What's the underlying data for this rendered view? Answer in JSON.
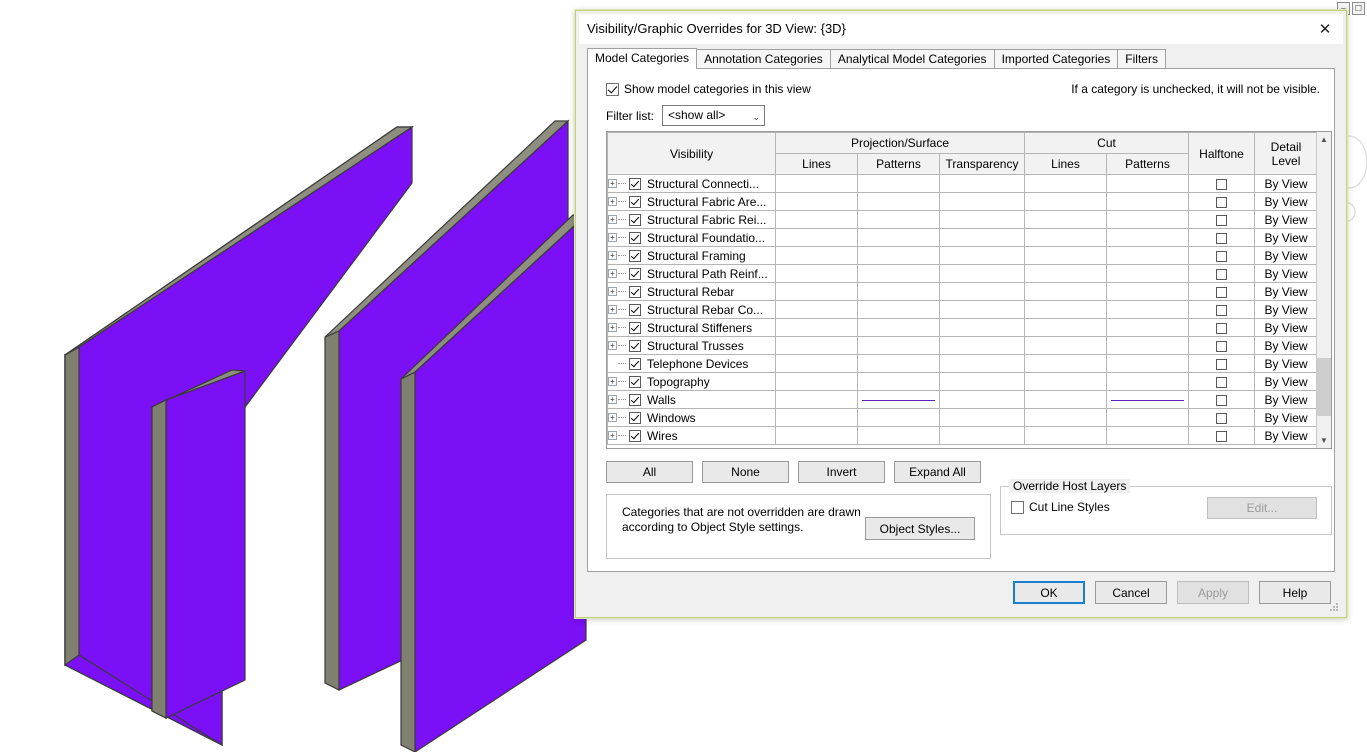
{
  "window": {
    "controls": [
      "minimize-icon",
      "restore-icon"
    ]
  },
  "view3d": {
    "name": "3D View {3D}",
    "wall_face_color": "#7B0FF5",
    "wall_edge_color": "#808070",
    "wall_outline_color": "#3a3a3a",
    "background": "#FFFFFF",
    "wall_count": 4
  },
  "dialog": {
    "title": "Visibility/Graphic Overrides for 3D View: {3D}",
    "close_label": "✕",
    "border_color": "#C0D17A",
    "tabs": [
      {
        "label": "Model Categories",
        "active": true
      },
      {
        "label": "Annotation Categories",
        "active": false
      },
      {
        "label": "Analytical Model Categories",
        "active": false
      },
      {
        "label": "Imported Categories",
        "active": false
      },
      {
        "label": "Filters",
        "active": false
      }
    ],
    "show_categories": {
      "label": "Show model categories in this view",
      "checked": true
    },
    "hint": "If a category is unchecked, it will not be visible.",
    "filter": {
      "label": "Filter list:",
      "value": "<show all>",
      "arrow": "⌄"
    },
    "grid": {
      "headers": {
        "visibility": "Visibility",
        "projection_surface": "Projection/Surface",
        "cut": "Cut",
        "lines": "Lines",
        "patterns": "Patterns",
        "transparency": "Transparency",
        "cut_lines": "Lines",
        "cut_patterns": "Patterns",
        "halftone": "Halftone",
        "detail_level": "Detail\nLevel",
        "detail_level_l1": "Detail",
        "detail_level_l2": "Level"
      },
      "rows": [
        {
          "name": "Structural Connecti...",
          "expandable": true,
          "checked": true,
          "detail": "By View",
          "halftone": false,
          "hatch": [],
          "purple": []
        },
        {
          "name": "Structural Fabric Are...",
          "expandable": true,
          "checked": true,
          "detail": "By View",
          "halftone": false,
          "hatch": [
            "pat",
            "trans",
            "cutpat"
          ],
          "purple": []
        },
        {
          "name": "Structural Fabric Rei...",
          "expandable": true,
          "checked": true,
          "detail": "By View",
          "halftone": false,
          "hatch": [
            "pat",
            "trans",
            "cutpat"
          ],
          "purple": []
        },
        {
          "name": "Structural Foundatio...",
          "expandable": true,
          "checked": true,
          "detail": "By View",
          "halftone": false,
          "hatch": [],
          "purple": []
        },
        {
          "name": "Structural Framing",
          "expandable": true,
          "checked": true,
          "detail": "By View",
          "halftone": false,
          "hatch": [],
          "purple": []
        },
        {
          "name": "Structural Path Reinf...",
          "expandable": true,
          "checked": true,
          "detail": "By View",
          "halftone": false,
          "hatch": [
            "pat",
            "cutpat"
          ],
          "purple": []
        },
        {
          "name": "Structural Rebar",
          "expandable": true,
          "checked": true,
          "detail": "By View",
          "halftone": false,
          "hatch": [],
          "purple": []
        },
        {
          "name": "Structural Rebar Co...",
          "expandable": true,
          "checked": true,
          "detail": "By View",
          "halftone": false,
          "hatch": [
            "cutline",
            "cutpat"
          ],
          "selected": true,
          "purple": []
        },
        {
          "name": "Structural Stiffeners",
          "expandable": true,
          "checked": true,
          "detail": "By View",
          "halftone": false,
          "hatch": [
            "pat",
            "cutpat"
          ],
          "purple": []
        },
        {
          "name": "Structural Trusses",
          "expandable": true,
          "checked": true,
          "detail": "By View",
          "halftone": false,
          "hatch": [
            "pat",
            "cutline",
            "cutpat"
          ],
          "purple": []
        },
        {
          "name": "Telephone Devices",
          "expandable": false,
          "checked": true,
          "detail": "By View",
          "halftone": false,
          "hatch": [
            "pat",
            "cutline",
            "cutpat"
          ],
          "purple": []
        },
        {
          "name": "Topography",
          "expandable": true,
          "checked": true,
          "detail": "By View",
          "halftone": false,
          "hatch": [],
          "purple": []
        },
        {
          "name": "Walls",
          "expandable": true,
          "checked": true,
          "detail": "By View",
          "halftone": false,
          "hatch": [],
          "purple": [
            "pat",
            "cutpat"
          ]
        },
        {
          "name": "Windows",
          "expandable": true,
          "checked": true,
          "detail": "By View",
          "halftone": false,
          "hatch": [],
          "purple": []
        },
        {
          "name": "Wires",
          "expandable": true,
          "checked": true,
          "detail": "By View",
          "halftone": false,
          "hatch": [
            "pat",
            "cutline",
            "cutpat"
          ],
          "purple": []
        }
      ]
    },
    "selection_buttons": [
      {
        "label": "All"
      },
      {
        "label": "None"
      },
      {
        "label": "Invert"
      },
      {
        "label": "Expand All"
      }
    ],
    "note": {
      "line1": "Categories that are not overridden are drawn",
      "line2": "according to Object Style settings.",
      "button": "Object Styles..."
    },
    "override_host_layers": {
      "legend": "Override Host Layers",
      "checkbox_label": "Cut Line Styles",
      "checked": false,
      "edit_button": "Edit...",
      "edit_disabled": true
    },
    "footer_buttons": [
      {
        "label": "OK",
        "default": true,
        "disabled": false
      },
      {
        "label": "Cancel",
        "default": false,
        "disabled": false
      },
      {
        "label": "Apply",
        "default": false,
        "disabled": true
      },
      {
        "label": "Help",
        "default": false,
        "disabled": false
      }
    ]
  },
  "annotations": {
    "color": "#E01B1B",
    "marks": [
      {
        "name": "projection-patterns-walls-circle",
        "shape": "ellipse"
      },
      {
        "name": "cut-patterns-walls-circle",
        "shape": "ellipse"
      }
    ]
  }
}
